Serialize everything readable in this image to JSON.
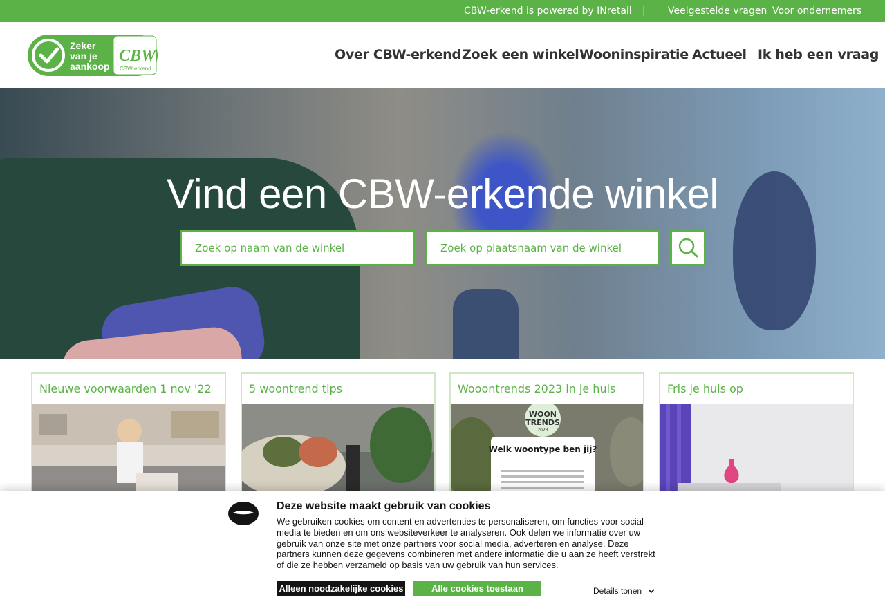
{
  "topbar": {
    "powered_by": "CBW-erkend is powered by INretail",
    "separator": "|",
    "faq": "Veelgestelde vragen",
    "entrepreneurs": "Voor ondernemers"
  },
  "logo": {
    "tagline": "Zeker van je aankoop",
    "brand": "CBW-erkend",
    "monogram": "CBW"
  },
  "nav": {
    "items": [
      "Over CBW-erkend",
      "Zoek een winkel",
      "Wooninspiratie",
      "Actueel",
      "Ik heb een vraag"
    ]
  },
  "hero": {
    "heading": "Vind een CBW-erkende winkel",
    "search_name_placeholder": "Zoek op naam van de winkel",
    "search_city_placeholder": "Zoek op plaatsnaam van de winkel",
    "search_icon": "search-icon"
  },
  "cards": [
    {
      "title": "Nieuwe voorwaarden 1 nov '22"
    },
    {
      "title": "5 woontrend tips"
    },
    {
      "title": "Wooontrends 2023 in je huis"
    },
    {
      "title": "Fris je huis op"
    }
  ],
  "card3_image": {
    "badge_line1": "WOON",
    "badge_line2": "TRENDS",
    "badge_year": "2023",
    "headline": "Welk woontype ben jij?"
  },
  "cookie": {
    "title": "Deze website maakt gebruik van cookies",
    "body": "We gebruiken cookies om content en advertenties te personaliseren, om functies voor social media te bieden en om ons websiteverkeer te analyseren. Ook delen we informatie over uw gebruik van onze site met onze partners voor social media, adverteren en analyse. Deze partners kunnen deze gegevens combineren met andere informatie die u aan ze heeft verstrekt of die ze hebben verzameld op basis van uw gebruik van hun services.",
    "necessary_label": "Alleen noodzakelijke cookies",
    "all_label": "Alle cookies toestaan",
    "details_label": "Details tonen"
  },
  "colors": {
    "brand_green": "#5bb347",
    "nav_text": "#333333",
    "cookie_dark": "#141414"
  }
}
